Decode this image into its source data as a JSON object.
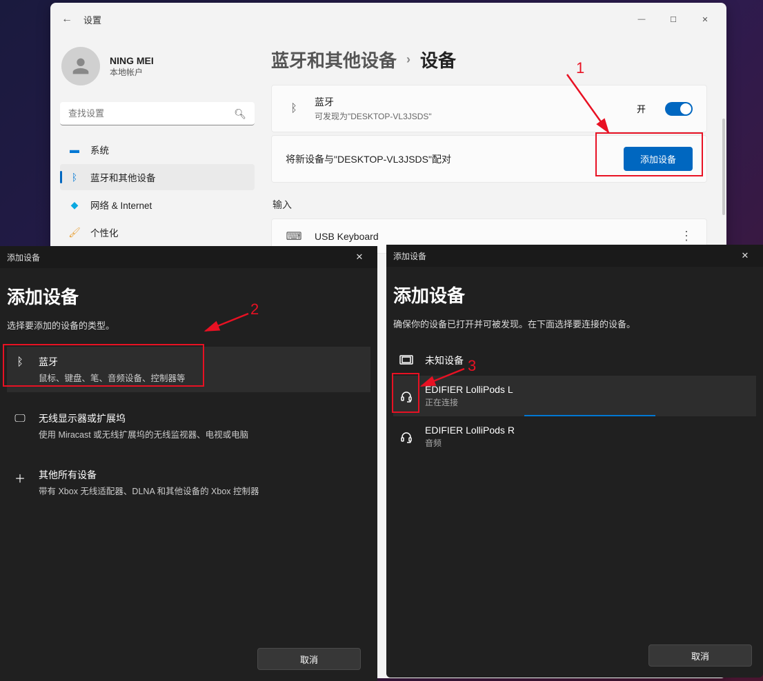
{
  "window": {
    "title": "设置",
    "user_name": "NING MEI",
    "user_sub": "本地帐户",
    "search_placeholder": "查找设置"
  },
  "nav": {
    "system": "系统",
    "bluetooth": "蓝牙和其他设备",
    "network": "网络 & Internet",
    "personalize": "个性化"
  },
  "breadcrumb": {
    "parent": "蓝牙和其他设备",
    "current": "设备"
  },
  "bt_card": {
    "title": "蓝牙",
    "sub": "可发现为\"DESKTOP-VL3JSDS\"",
    "toggle_label": "开"
  },
  "add_card": {
    "text": "将新设备与\"DESKTOP-VL3JSDS\"配对",
    "button": "添加设备"
  },
  "input_section": {
    "heading": "输入",
    "device": "USB Keyboard"
  },
  "annotations": {
    "n1": "1",
    "n2": "2",
    "n3": "3"
  },
  "dialog_left": {
    "titlebar": "添加设备",
    "heading": "添加设备",
    "sub": "选择要添加的设备的类型。",
    "items": [
      {
        "title": "蓝牙",
        "desc": "鼠标、键盘、笔、音频设备、控制器等"
      },
      {
        "title": "无线显示器或扩展坞",
        "desc": "使用 Miracast 或无线扩展坞的无线监视器、电视或电脑"
      },
      {
        "title": "其他所有设备",
        "desc": "带有 Xbox 无线适配器、DLNA 和其他设备的 Xbox 控制器"
      }
    ],
    "cancel": "取消"
  },
  "dialog_right": {
    "titlebar": "添加设备",
    "heading": "添加设备",
    "sub": "确保你的设备已打开并可被发现。在下面选择要连接的设备。",
    "devices": [
      {
        "name": "未知设备",
        "sub": ""
      },
      {
        "name": "EDIFIER LolliPods L",
        "sub": "正在连接"
      },
      {
        "name": "EDIFIER LolliPods R",
        "sub": "音频"
      }
    ],
    "cancel": "取消"
  }
}
